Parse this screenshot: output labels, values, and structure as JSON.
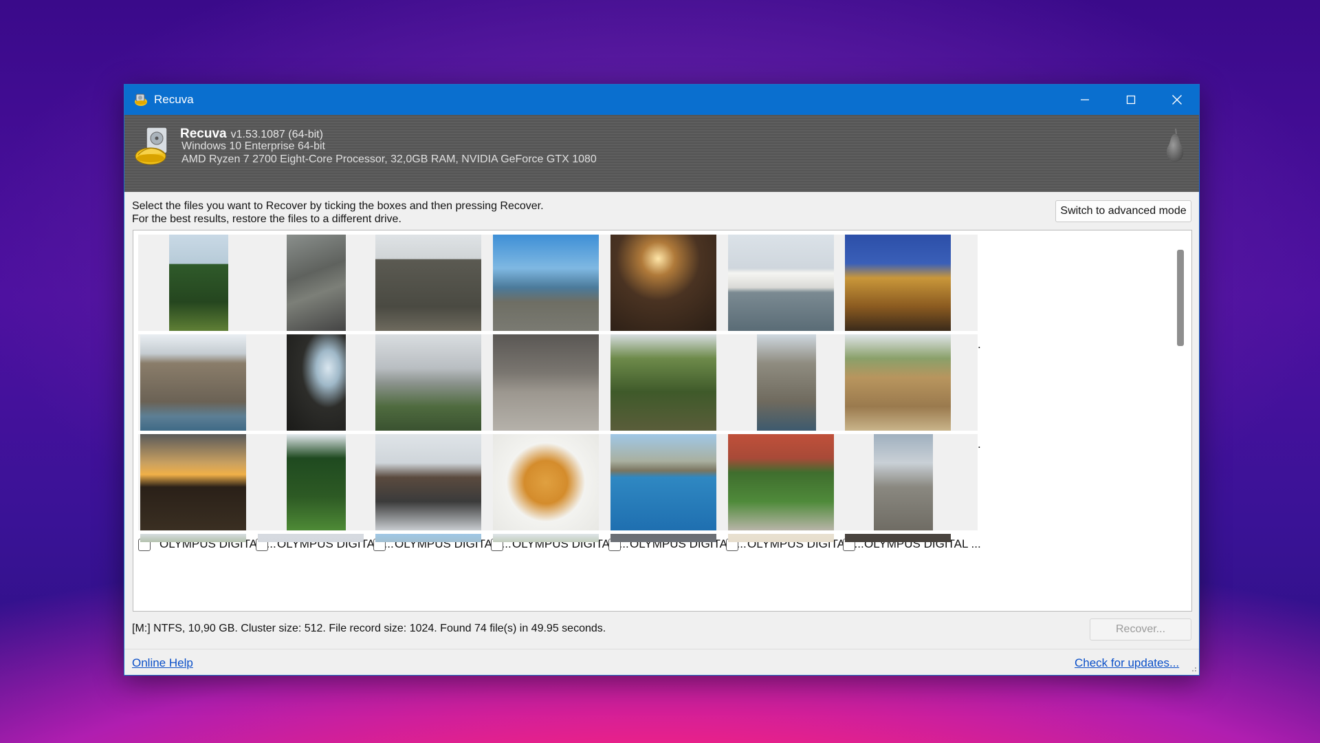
{
  "window": {
    "title": "Recuva"
  },
  "header": {
    "app_name": "Recuva",
    "version": "v1.53.1087 (64-bit)",
    "os": "Windows 10 Enterprise 64-bit",
    "hardware": "AMD Ryzen 7 2700 Eight-Core Processor, 32,0GB RAM, NVIDIA GeForce GTX 1080"
  },
  "instructions": {
    "line1": "Select the files you want to Recover by ticking the boxes and then pressing Recover.",
    "line2": "For the best results, restore the files to a different drive."
  },
  "buttons": {
    "advanced_mode": "Switch to advanced mode",
    "recover": "Recover..."
  },
  "files": [
    {
      "name": "OLYMPUS DIGITAL ...",
      "orientation": "portrait",
      "scene": "tree"
    },
    {
      "name": "OLYMPUS DIGITAL ...",
      "orientation": "portrait",
      "scene": "cliff"
    },
    {
      "name": "OLYMPUS DIGITAL ...",
      "orientation": "landscape",
      "scene": "castle"
    },
    {
      "name": "OLYMPUS DIGITAL ...",
      "orientation": "landscape",
      "scene": "pier"
    },
    {
      "name": "OLYMPUS DIGITAL ...",
      "orientation": "landscape",
      "scene": "hall"
    },
    {
      "name": "OLYMPUS DIGITAL ...",
      "orientation": "landscape",
      "scene": "yacht"
    },
    {
      "name": "OLYMPUS DIGITAL ...",
      "orientation": "landscape",
      "scene": "palace"
    },
    {
      "name": "OLYMPUS DIGITAL ...",
      "orientation": "landscape",
      "scene": "coast"
    },
    {
      "name": "OLYMPUS DIGITAL ...",
      "orientation": "portrait",
      "scene": "cave"
    },
    {
      "name": "OLYMPUS DIGITAL ...",
      "orientation": "landscape",
      "scene": "mountain"
    },
    {
      "name": "OLYMPUS DIGITAL ...",
      "orientation": "landscape",
      "scene": "statues"
    },
    {
      "name": "OLYMPUS DIGITAL ...",
      "orientation": "landscape",
      "scene": "forest"
    },
    {
      "name": "OLYMPUS DIGITAL ...",
      "orientation": "portrait",
      "scene": "rock"
    },
    {
      "name": "OLYMPUS DIGITAL ...",
      "orientation": "landscape",
      "scene": "ruins"
    },
    {
      "name": "OLYMPUS DIGITAL ...",
      "orientation": "landscape",
      "scene": "sunset"
    },
    {
      "name": "OLYMPUS DIGITAL ...",
      "orientation": "portrait",
      "scene": "cypress"
    },
    {
      "name": "OLYMPUS DIGITAL ...",
      "orientation": "landscape",
      "scene": "snow"
    },
    {
      "name": "OLYMPUS DIGITAL ...",
      "orientation": "landscape",
      "scene": "food"
    },
    {
      "name": "OLYMPUS DIGITAL ...",
      "orientation": "landscape",
      "scene": "sea"
    },
    {
      "name": "OLYMPUS DIGITAL ...",
      "orientation": "landscape",
      "scene": "garden"
    },
    {
      "name": "OLYMPUS DIGITAL ...",
      "orientation": "portrait",
      "scene": "nest"
    }
  ],
  "partial_row": [
    "forest",
    "sky",
    "sea",
    "ruins",
    "sky2",
    "sand",
    "dark"
  ],
  "status": "[M:] NTFS, 10,90 GB. Cluster size: 512. File record size: 1024. Found 74 file(s) in 49.95 seconds.",
  "links": {
    "help": "Online Help",
    "updates": "Check for updates..."
  },
  "colors": {
    "titlebar": "#0a6fcf",
    "link": "#0a4fc8"
  }
}
